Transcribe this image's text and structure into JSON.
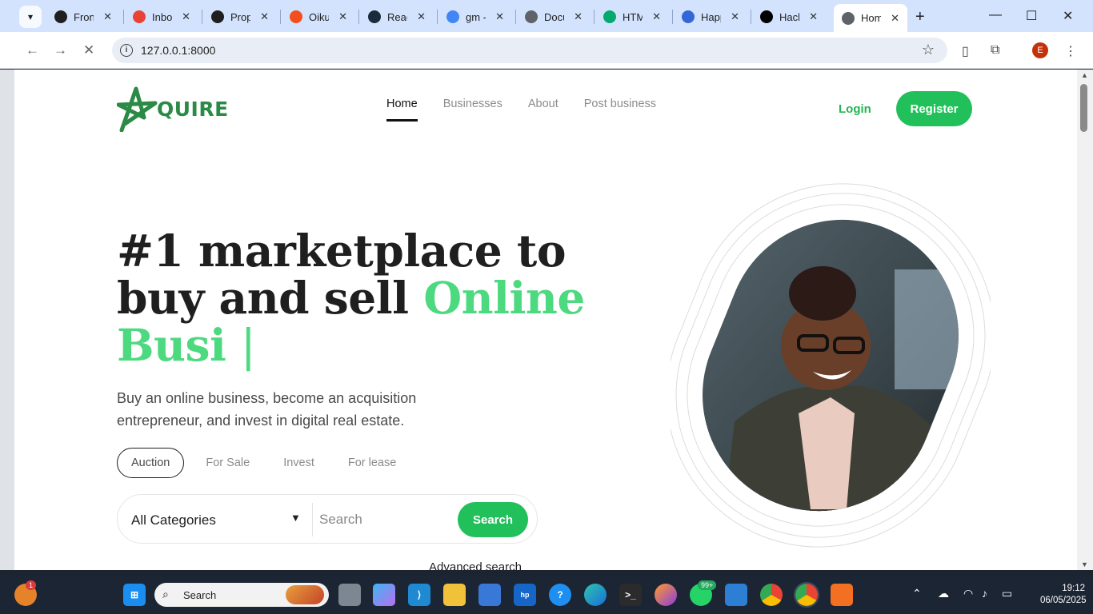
{
  "browser": {
    "tabs": [
      {
        "title": "Front",
        "icon": "openai-icon",
        "color": "#1f1f1f"
      },
      {
        "title": "Inbox",
        "icon": "gmail-icon",
        "color": "#ea4335"
      },
      {
        "title": "Prope",
        "icon": "github-icon",
        "color": "#1f1f1f"
      },
      {
        "title": "Oikun",
        "icon": "figma-icon",
        "color": "#f24e1e"
      },
      {
        "title": "React",
        "icon": "react-icon",
        "color": "#1a2b3c"
      },
      {
        "title": "gm -",
        "icon": "google-icon",
        "color": "#4285f4"
      },
      {
        "title": "Docu",
        "icon": "globe-icon",
        "color": "#5f6368"
      },
      {
        "title": "HTM",
        "icon": "w3-icon",
        "color": "#04aa6d"
      },
      {
        "title": "Happ",
        "icon": "chat-icon",
        "color": "#3367d6"
      },
      {
        "title": "Hack",
        "icon": "terminal-icon",
        "color": "#000000"
      },
      {
        "title": "Hom",
        "icon": "loading-icon",
        "color": "#5f6368",
        "active": true
      }
    ],
    "url": "127.0.0.1:8000",
    "profile_initial": "E"
  },
  "site": {
    "logo_text": "QUIRE",
    "nav": [
      {
        "label": "Home",
        "active": true
      },
      {
        "label": "Businesses"
      },
      {
        "label": "About"
      },
      {
        "label": "Post business"
      }
    ],
    "login_label": "Login",
    "register_label": "Register",
    "headline_part1": "#1 marketplace to buy and sell ",
    "headline_highlight": "Online Busi",
    "headline_caret": "|",
    "subtext": "Buy an online business, become an acquisition entrepreneur, and invest in digital real estate.",
    "listing_tabs": [
      {
        "label": "Auction",
        "active": true
      },
      {
        "label": "For Sale"
      },
      {
        "label": "Invest"
      },
      {
        "label": "For lease"
      }
    ],
    "search": {
      "category": "All Categories",
      "placeholder": "Search",
      "button_label": "Search"
    },
    "advanced_search_label": "Advanced search",
    "brand_green": "#22c05a",
    "accent_green": "#4cd97f"
  },
  "taskbar": {
    "search_label": "Search",
    "whatsapp_badge": "99+",
    "weather_badge": "1",
    "time": "19:12",
    "date": "06/05/2025"
  }
}
